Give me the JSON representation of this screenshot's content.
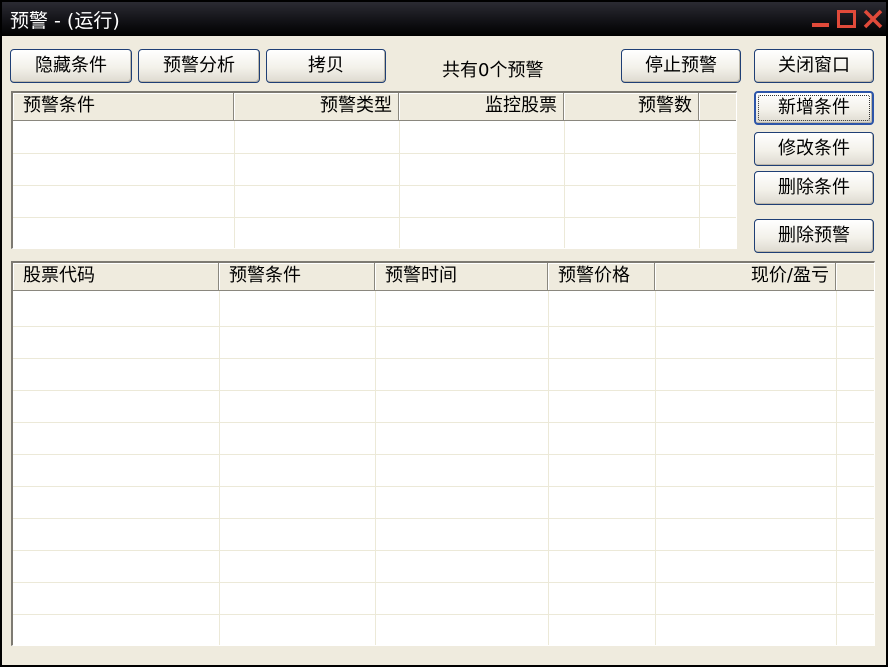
{
  "window": {
    "title": "预警 - (运行)"
  },
  "toolbar": {
    "hide_conditions": "隐藏条件",
    "alert_analysis": "预警分析",
    "copy": "拷贝",
    "alert_count": "共有0个预警",
    "stop_alert": "停止预警",
    "close_window": "关闭窗口"
  },
  "side_buttons": {
    "add_condition": "新增条件",
    "modify_condition": "修改条件",
    "delete_condition": "删除条件",
    "delete_alert": "删除预警"
  },
  "conditions_table": {
    "columns": [
      "预警条件",
      "预警类型",
      "监控股票",
      "预警数"
    ],
    "rows": []
  },
  "alerts_table": {
    "columns": [
      "股票代码",
      "预警条件",
      "预警时间",
      "预警价格",
      "现价/盈亏"
    ],
    "rows": []
  },
  "colors": {
    "window_bg": "#efebde",
    "button_border": "#1f3f75",
    "close_icon": "#e04a3a"
  }
}
